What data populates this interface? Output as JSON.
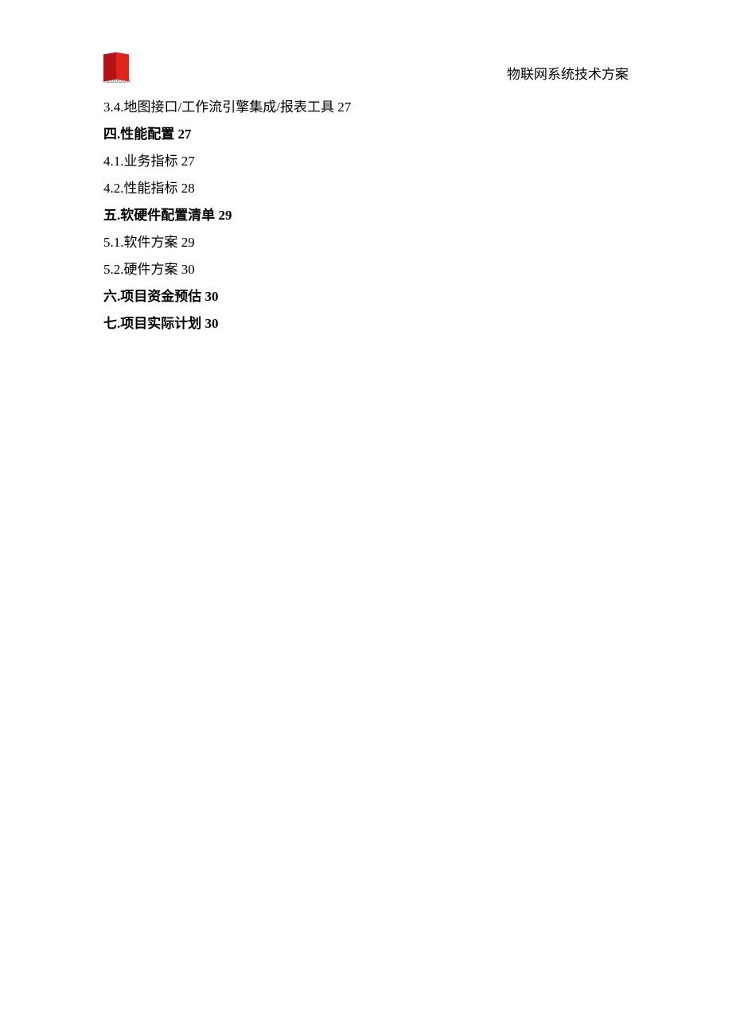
{
  "header": {
    "logo_caption": "REDDOOR",
    "doc_title": "物联网系统技术方案"
  },
  "toc": [
    {
      "text": "3.4.地图接口/工作流引擎集成/报表工具 27",
      "bold": false
    },
    {
      "text": "四.性能配置 27",
      "bold": true
    },
    {
      "text": "4.1.业务指标 27",
      "bold": false
    },
    {
      "text": "4.2.性能指标 28",
      "bold": false
    },
    {
      "text": "五.软硬件配置清单 29",
      "bold": true
    },
    {
      "text": "5.1.软件方案 29",
      "bold": false
    },
    {
      "text": "5.2.硬件方案 30",
      "bold": false
    },
    {
      "text": "六.项目资金预估 30",
      "bold": true
    },
    {
      "text": "七.项目实际计划 30",
      "bold": true
    }
  ]
}
